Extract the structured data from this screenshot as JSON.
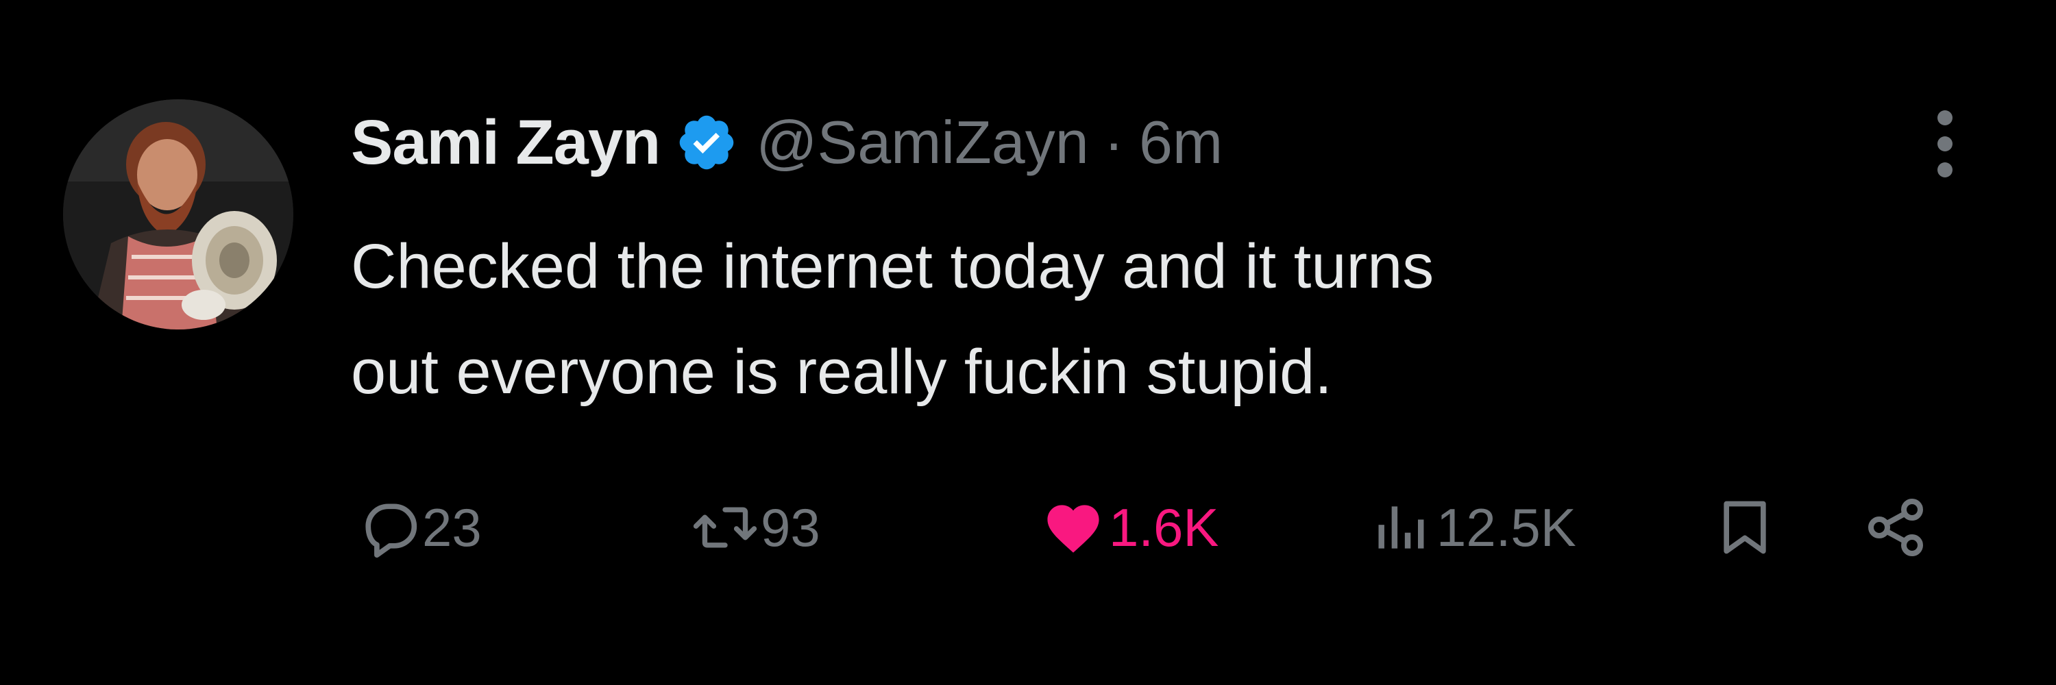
{
  "author": {
    "display_name": "Sami Zayn",
    "handle": "@SamiZayn",
    "separator": "·",
    "timestamp": "6m",
    "verified": true
  },
  "tweet": {
    "text_lines": [
      "Checked the internet today and it turns",
      "out everyone is really fuckin stupid."
    ]
  },
  "actions": {
    "reply_count": "23",
    "retweet_count": "93",
    "like_count": "1.6K",
    "liked": true,
    "views_count": "12.5K"
  },
  "icons": {
    "verified": "verified-badge-icon",
    "more": "more-vertical-icon",
    "reply": "reply-bubble-icon",
    "retweet": "retweet-icon",
    "like": "heart-icon",
    "views": "views-bar-chart-icon",
    "bookmark": "bookmark-icon",
    "share": "share-icon"
  },
  "colors": {
    "background": "#000000",
    "primary_text": "#e7e9ea",
    "secondary_text": "#71767b",
    "like_pink": "#f91880",
    "verified_blue": "#1d9bf0"
  }
}
